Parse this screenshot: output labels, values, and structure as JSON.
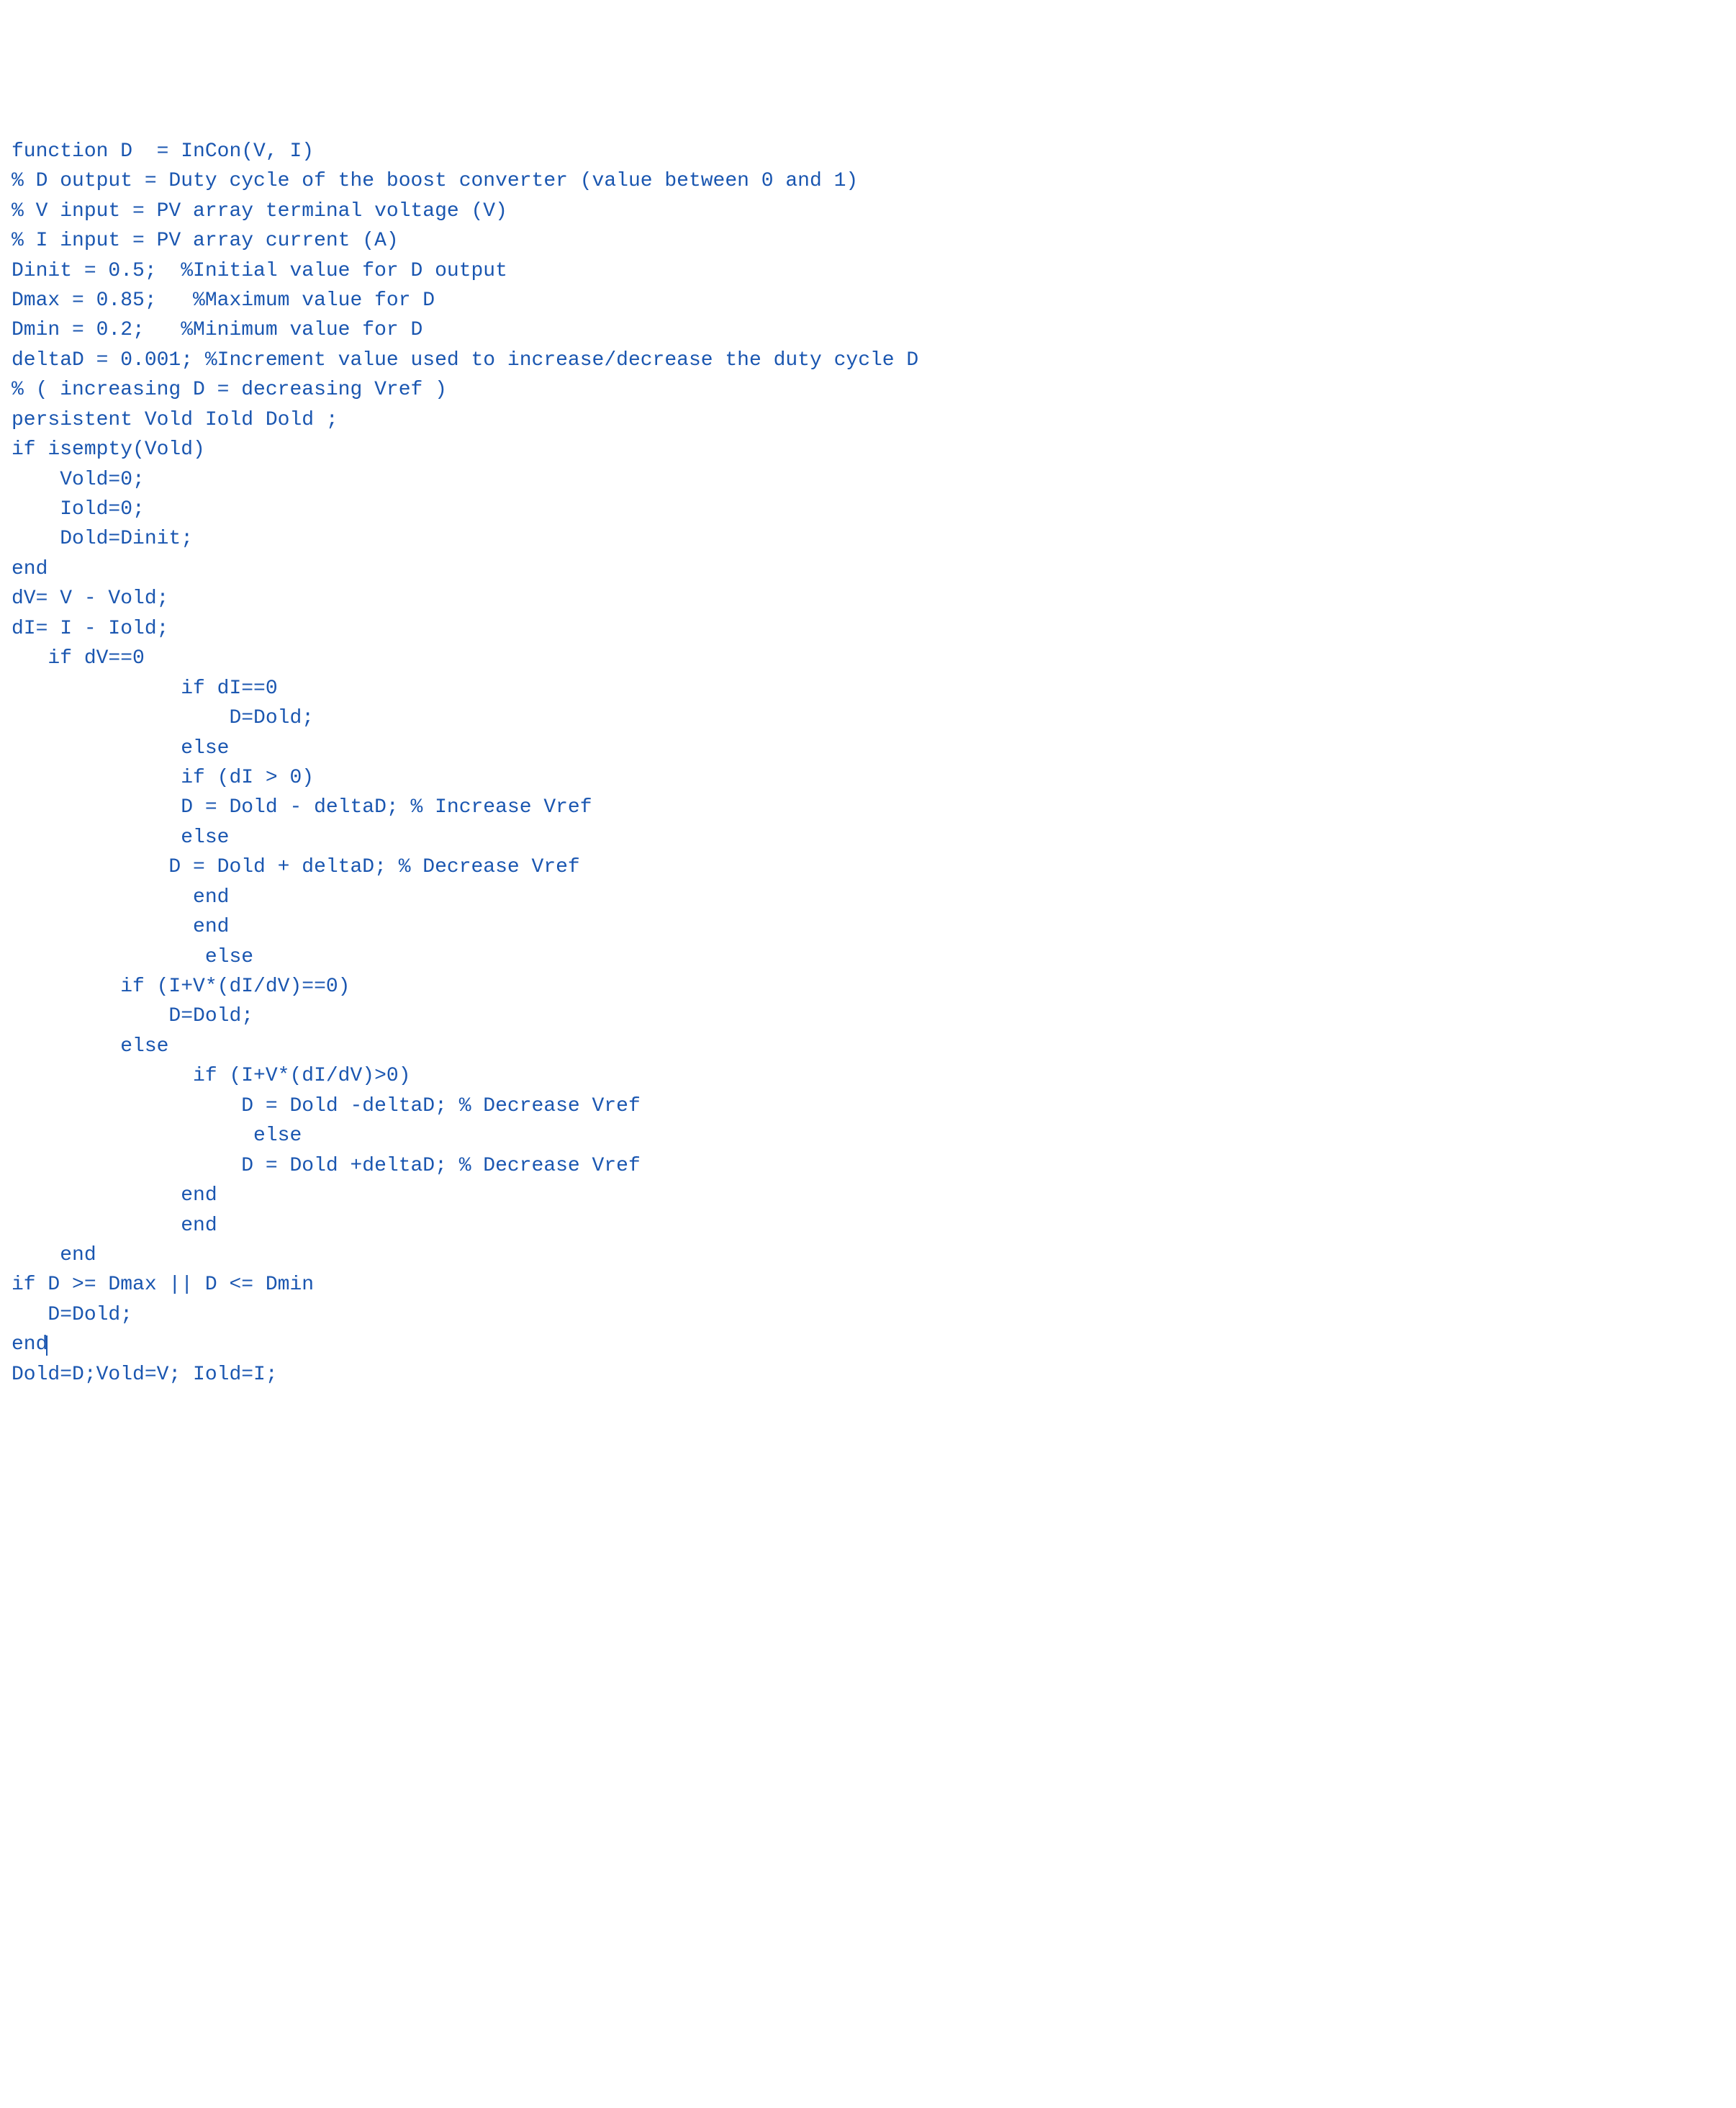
{
  "code_lines": [
    "function D  = InCon(V, I)",
    "% D output = Duty cycle of the boost converter (value between 0 and 1)",
    "% V input = PV array terminal voltage (V)",
    "% I input = PV array current (A)",
    "Dinit = 0.5;  %Initial value for D output",
    "Dmax = 0.85;   %Maximum value for D",
    "Dmin = 0.2;   %Minimum value for D",
    "deltaD = 0.001; %Increment value used to increase/decrease the duty cycle D",
    "% ( increasing D = decreasing Vref )",
    "persistent Vold Iold Dold ;",
    "if isempty(Vold)",
    "    Vold=0;",
    "    Iold=0;",
    "    Dold=Dinit;",
    "end",
    "dV= V - Vold;",
    "dI= I - Iold;",
    "   if dV==0",
    "              if dI==0",
    "                  D=Dold;",
    "              else",
    "              if (dI > 0)",
    "              D = Dold - deltaD; % Increase Vref",
    "              else",
    "             D = Dold + deltaD; % Decrease Vref",
    "               end",
    "               end",
    "                else",
    "         if (I+V*(dI/dV)==0)",
    "             D=Dold;",
    "         else",
    "               if (I+V*(dI/dV)>0)",
    "                   D = Dold -deltaD; % Decrease Vref",
    "                    else",
    "                   D = Dold +deltaD; % Decrease Vref",
    "              end",
    "              end",
    "    end",
    "if D >= Dmax || D <= Dmin",
    "   D=Dold;",
    "end",
    "Dold=D;Vold=V; Iold=I;"
  ]
}
